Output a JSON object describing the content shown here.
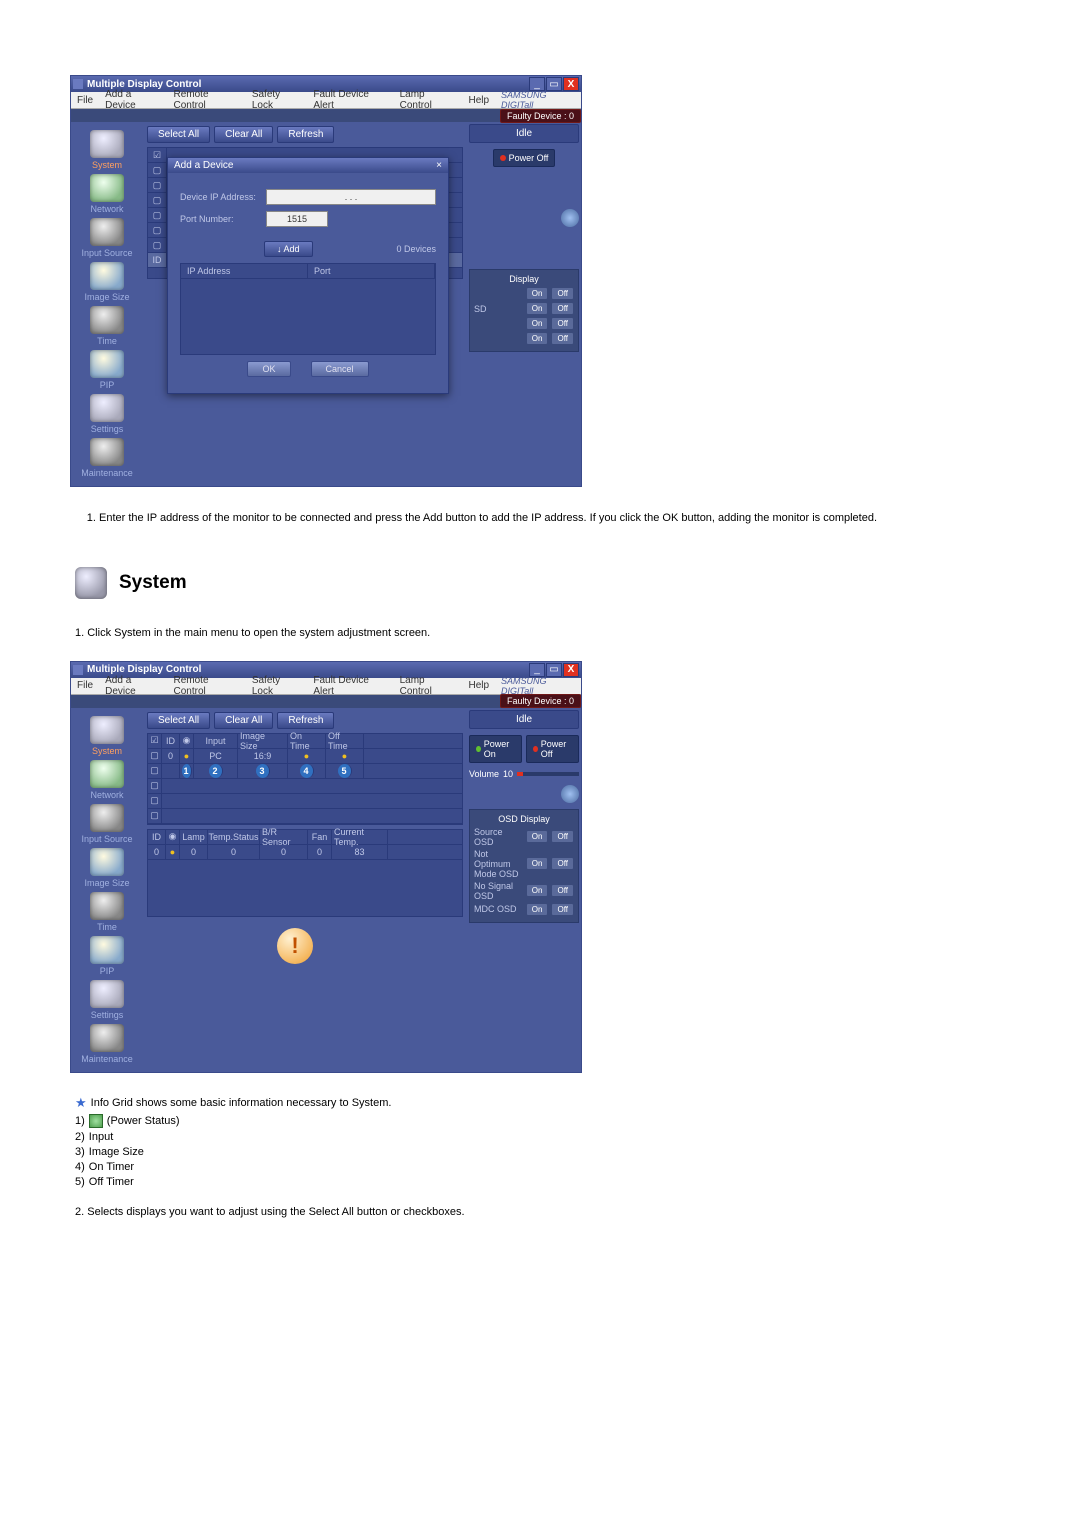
{
  "window": {
    "title": "Multiple Display Control",
    "menus": [
      "File",
      "Add a Device",
      "Remote Control",
      "Safety Lock",
      "Fault Device Alert",
      "Lamp Control",
      "Help"
    ],
    "brand": "SAMSUNG DIGITall",
    "fault": "Faulty Device : 0"
  },
  "sidebar": [
    "System",
    "Network",
    "Input Source",
    "Image Size",
    "Time",
    "PIP",
    "Settings",
    "Maintenance"
  ],
  "toolbar": {
    "selectAll": "Select All",
    "clearAll": "Clear All",
    "refresh": "Refresh"
  },
  "right1": {
    "idle": "Idle",
    "powerOff": "Power Off",
    "osdTitle": "Display",
    "osdSuffix": "SD",
    "on": "On",
    "off": "Off"
  },
  "dialog": {
    "title": "Add a Device",
    "ipLabel": "Device IP Address:",
    "portLabel": "Port Number:",
    "port": "1515",
    "ipDots": ".    .    .",
    "add": "Add",
    "count": "0 Devices",
    "colIp": "IP Address",
    "colPort": "Port",
    "ok": "OK",
    "cancel": "Cancel"
  },
  "grid1": {
    "id": "ID"
  },
  "instr1": "Enter the IP address of the monitor to be connected and press the Add button to add the IP address. If you click the OK button, adding the monitor is completed.",
  "section2": {
    "title": "System",
    "lead": "Click System in the main menu to open the system adjustment screen."
  },
  "right2": {
    "idle": "Idle",
    "powerOn": "Power On",
    "powerOff": "Power Off",
    "volume": "Volume",
    "volVal": "10",
    "osdTitle": "OSD Display",
    "rows": [
      "Source OSD",
      "Not Optimum Mode OSD",
      "No Signal OSD",
      "MDC OSD"
    ],
    "on": "On",
    "off": "Off"
  },
  "table2": {
    "hdr1": [
      "",
      "ID",
      "",
      "Input",
      "Image Size",
      "On Time",
      "Off Time"
    ],
    "row1": [
      "",
      "0",
      "",
      "PC",
      "16:9",
      "",
      ""
    ],
    "hdr2": [
      "ID",
      "",
      "Lamp",
      "Temp.Status",
      "B/R Sensor",
      "Fan",
      "Current Temp."
    ],
    "row2": [
      "0",
      "",
      "0",
      "0",
      "0",
      "0",
      "83"
    ]
  },
  "legend": {
    "lead": "Info Grid shows some basic information necessary to System.",
    "items": [
      "(Power Status)",
      "Input",
      "Image Size",
      "On Timer",
      "Off Timer"
    ]
  },
  "instr2": "Selects displays you want to adjust using the Select All button or checkboxes."
}
